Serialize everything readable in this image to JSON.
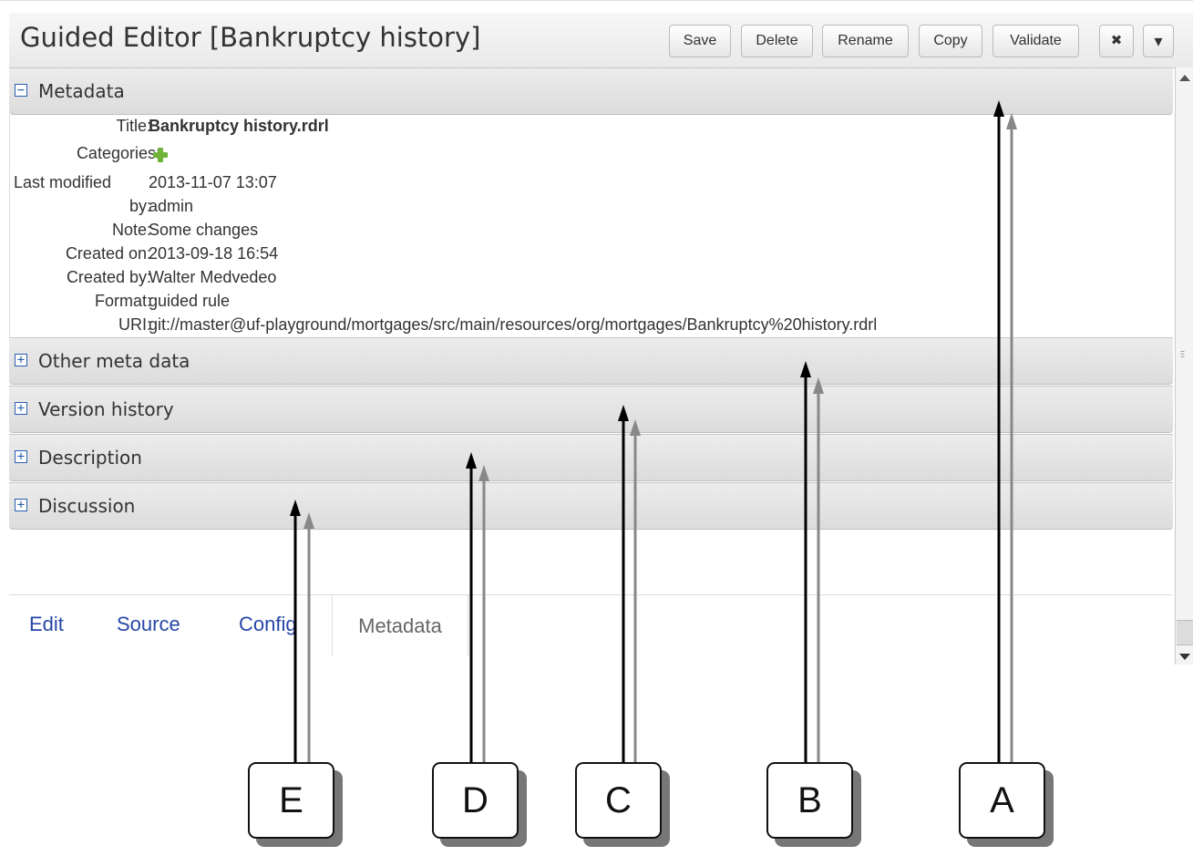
{
  "header": {
    "title": "Guided Editor [Bankruptcy history]",
    "buttons": {
      "save": "Save",
      "delete": "Delete",
      "rename": "Rename",
      "copy": "Copy",
      "validate": "Validate",
      "close": "✖",
      "menu": "▾"
    }
  },
  "sections": {
    "metadata": "Metadata",
    "other_meta": "Other meta data",
    "version_history": "Version history",
    "description": "Description",
    "discussion": "Discussion"
  },
  "metadata": {
    "title_label": "Title:",
    "title_value": "Bankruptcy history.rdrl",
    "categories_label": "Categories:",
    "last_modified_label": "Last modified",
    "last_modified_value": "2013-11-07 13:07",
    "by_label": "by:",
    "by_value": "admin",
    "note_label": "Note:",
    "note_value": "Some changes",
    "created_on_label": "Created on:",
    "created_on_value": "2013-09-18 16:54",
    "created_by_label": "Created by:",
    "created_by_value": "Walter Medvedeo",
    "format_label": "Format:",
    "format_value": "guided rule",
    "uri_label": "URI:",
    "uri_value": "git://master@uf-playground/mortgages/src/main/resources/org/mortgages/Bankruptcy%20history.rdrl"
  },
  "tabs": [
    "Edit",
    "Source",
    "Config",
    "Metadata"
  ],
  "callouts": [
    "A",
    "B",
    "C",
    "D",
    "E"
  ],
  "icons": {
    "toggle_collapse": "minus-box-icon",
    "toggle_expand": "plus-box-icon",
    "add_category": "green-plus-icon"
  },
  "colors": {
    "link_blue": "#2646a8",
    "add_green": "#6fb33a"
  }
}
